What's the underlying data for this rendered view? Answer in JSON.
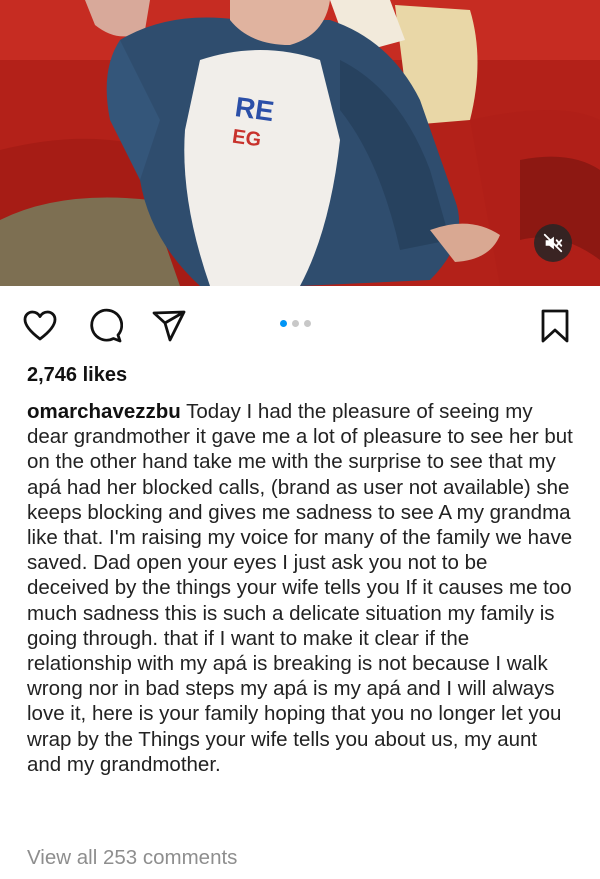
{
  "post": {
    "media": {
      "slide_count": 3,
      "active_slide": 1,
      "shirt_text_large": "RE",
      "shirt_text_small": "EG",
      "mute_icon": "speaker-muted-icon"
    },
    "actions": {
      "like_icon": "heart-outline-icon",
      "comment_icon": "comment-bubble-icon",
      "share_icon": "paper-plane-icon",
      "save_icon": "bookmark-outline-icon"
    },
    "likes_text": "2,746 likes",
    "caption": {
      "username": "omarchavezzbu",
      "text": "Today I had the pleasure of seeing my dear grandmother it gave me a lot of pleasure to see her but on the other hand take me with the surprise to see that my apá had her blocked calls, (brand as user not available) she keeps blocking and gives me sadness to see A my grandma like that. I'm raising my voice for many of the family we have saved. Dad open your eyes I just ask you not to be deceived by the things your wife tells you If it causes me too much sadness this is such a delicate situation my family is going through. that if I want to make it clear if the relationship with my apá is breaking is not because I walk wrong nor in bad steps my apá is my apá and I will always love it, here is your family hoping that you no longer let you wrap by the Things your wife tells you about us, my aunt and my grandmother."
    },
    "comments_link": "View all 253 comments"
  },
  "colors": {
    "accent_dot": "#0095f6",
    "muted_text": "#8e8e8e",
    "couch_red": "#b8231d",
    "jacket_blue": "#2f4d6e"
  }
}
